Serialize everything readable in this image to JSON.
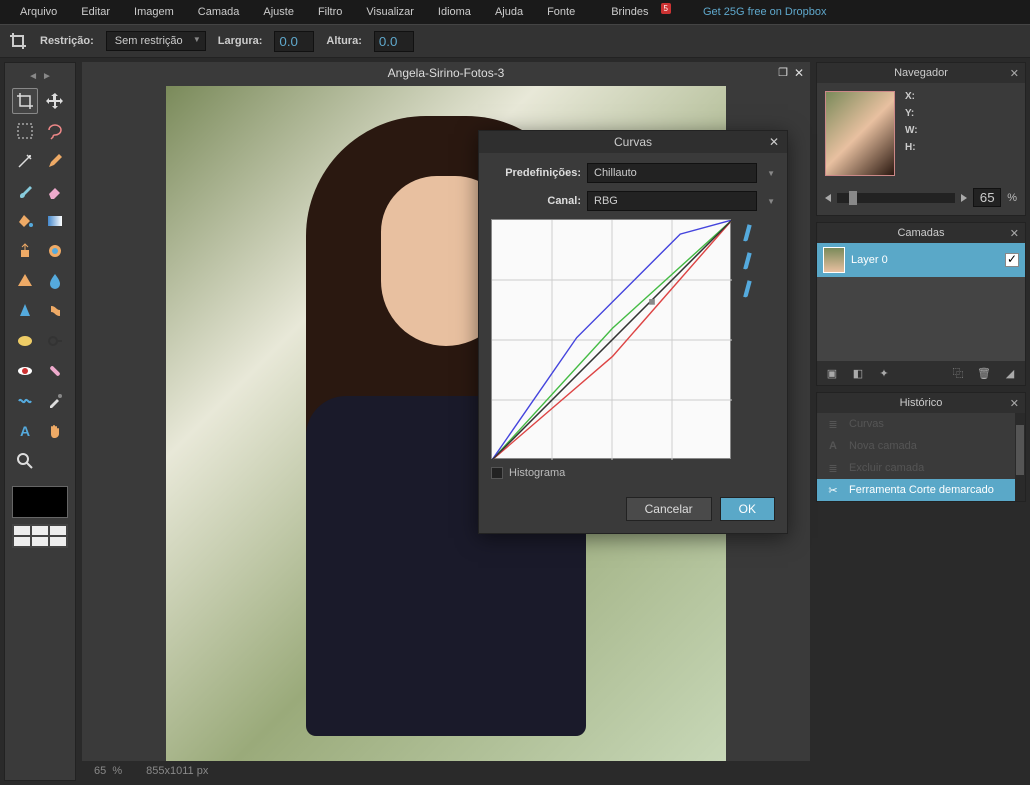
{
  "menu": [
    "Arquivo",
    "Editar",
    "Imagem",
    "Camada",
    "Ajuste",
    "Filtro",
    "Visualizar",
    "Idioma",
    "Ajuda",
    "Fonte",
    "Brindes"
  ],
  "menu_badge": "5",
  "promo": "Get 25G free on Dropbox",
  "option": {
    "restricao_label": "Restrição:",
    "restricao_value": "Sem restrição",
    "largura_label": "Largura:",
    "largura_value": "0.0",
    "altura_label": "Altura:",
    "altura_value": "0.0"
  },
  "doc_title": "Angela-Sirino-Fotos-3",
  "status": {
    "zoom": "65",
    "zoom_pct": "%",
    "dims": "855x1011 px"
  },
  "navigator": {
    "title": "Navegador",
    "x": "X:",
    "y": "Y:",
    "w": "W:",
    "h": "H:",
    "zoom": "65",
    "pct": "%"
  },
  "layers": {
    "title": "Camadas",
    "layer0": "Layer 0"
  },
  "history": {
    "title": "Histórico",
    "items": [
      "Curvas",
      "Nova camada",
      "Excluir camada",
      "Ferramenta Corte demarcado"
    ]
  },
  "curves": {
    "title": "Curvas",
    "preset_label": "Predefinições:",
    "preset_value": "Chillauto",
    "channel_label": "Canal:",
    "channel_value": "RBG",
    "hist_label": "Histograma",
    "cancel": "Cancelar",
    "ok": "OK"
  },
  "chart_data": {
    "type": "line",
    "title": "Curvas",
    "xlabel": "",
    "ylabel": "",
    "xlim": [
      0,
      255
    ],
    "ylim": [
      0,
      255
    ],
    "series": [
      {
        "name": "diagonal",
        "color": "#888",
        "values": [
          [
            0,
            0
          ],
          [
            255,
            255
          ]
        ]
      },
      {
        "name": "R",
        "color": "#d44",
        "values": [
          [
            0,
            0
          ],
          [
            128,
            110
          ],
          [
            255,
            255
          ]
        ]
      },
      {
        "name": "G",
        "color": "#4b4",
        "values": [
          [
            0,
            0
          ],
          [
            128,
            140
          ],
          [
            255,
            255
          ]
        ]
      },
      {
        "name": "B",
        "color": "#44d",
        "values": [
          [
            0,
            0
          ],
          [
            90,
            130
          ],
          [
            200,
            240
          ],
          [
            255,
            255
          ]
        ]
      },
      {
        "name": "RGB",
        "color": "#333",
        "values": [
          [
            0,
            0
          ],
          [
            170,
            170
          ],
          [
            255,
            255
          ]
        ]
      }
    ]
  }
}
